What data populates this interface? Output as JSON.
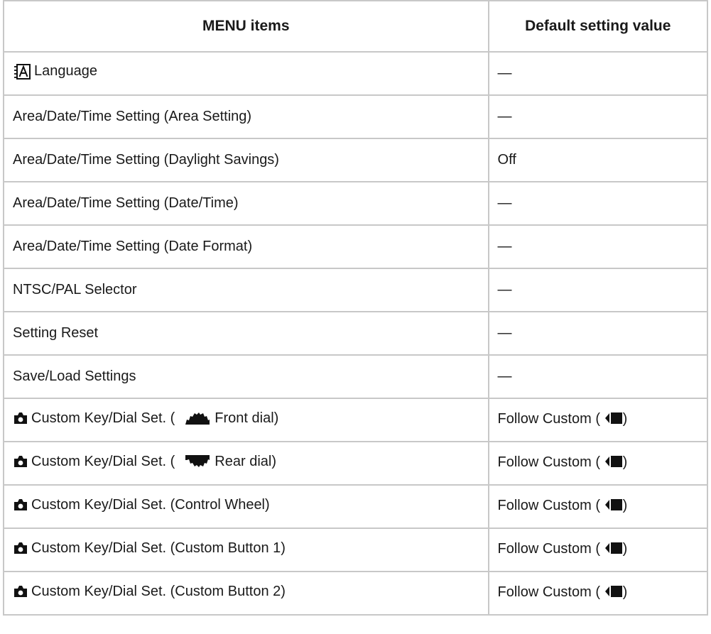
{
  "table": {
    "headers": {
      "menu_items": "MENU items",
      "default_value": "Default setting value"
    },
    "rows": [
      {
        "icon": "language-icon",
        "item": "Language",
        "value": "—"
      },
      {
        "icon": "",
        "item": "Area/Date/Time Setting (Area Setting)",
        "value": "—"
      },
      {
        "icon": "",
        "item": "Area/Date/Time Setting (Daylight Savings)",
        "value": "Off"
      },
      {
        "icon": "",
        "item": "Area/Date/Time Setting (Date/Time)",
        "value": "—"
      },
      {
        "icon": "",
        "item": "Area/Date/Time Setting (Date Format)",
        "value": "—"
      },
      {
        "icon": "",
        "item": "NTSC/PAL Selector",
        "value": "—"
      },
      {
        "icon": "",
        "item": "Setting Reset",
        "value": "—"
      },
      {
        "icon": "",
        "item": "Save/Load Settings",
        "value": "—"
      },
      {
        "icon": "camera-icon",
        "item_prefix": "Custom Key/Dial Set. (",
        "dial_icon": "front-dial-icon",
        "item_suffix": "Front dial)",
        "value_prefix": "Follow Custom (",
        "value_icon": "movie-icon",
        "value_suffix": ")"
      },
      {
        "icon": "camera-icon",
        "item_prefix": "Custom Key/Dial Set. (",
        "dial_icon": "rear-dial-icon",
        "item_suffix": "Rear dial)",
        "value_prefix": "Follow Custom (",
        "value_icon": "movie-icon",
        "value_suffix": ")"
      },
      {
        "icon": "camera-icon",
        "item": "Custom Key/Dial Set. (Control Wheel)",
        "value_prefix": "Follow Custom (",
        "value_icon": "movie-icon",
        "value_suffix": ")"
      },
      {
        "icon": "camera-icon",
        "item": "Custom Key/Dial Set. (Custom Button 1)",
        "value_prefix": "Follow Custom (",
        "value_icon": "movie-icon",
        "value_suffix": ")"
      },
      {
        "icon": "camera-icon",
        "item": "Custom Key/Dial Set. (Custom Button 2)",
        "value_prefix": "Follow Custom (",
        "value_icon": "movie-icon",
        "value_suffix": ")"
      }
    ]
  }
}
